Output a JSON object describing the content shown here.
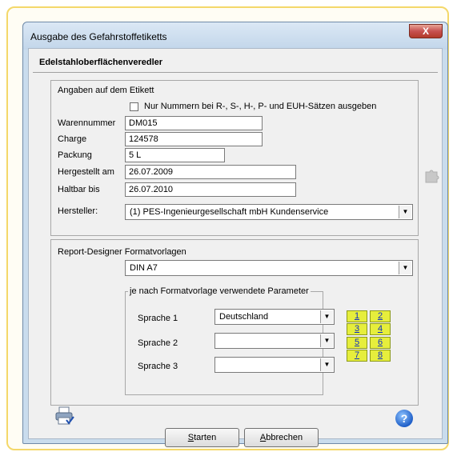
{
  "window": {
    "title": "Ausgabe des Gefahrstoffetiketts",
    "close_glyph": "X"
  },
  "company_name": "Edelstahloberflächenveredler",
  "label_group": {
    "title": "Angaben auf dem Etikett",
    "only_numbers_checkbox_label": "Nur Nummern bei R-, S-, H-, P- und EUH-Sätzen ausgeben",
    "only_numbers_checked": false,
    "fields": {
      "warennummer": {
        "label": "Warennummer",
        "value": "DM015"
      },
      "charge": {
        "label": "Charge",
        "value": "124578"
      },
      "packung": {
        "label": "Packung",
        "value": "5 L"
      },
      "hergestellt": {
        "label": "Hergestellt am",
        "value": "26.07.2009"
      },
      "haltbar": {
        "label": "Haltbar bis",
        "value": "26.07.2010"
      }
    },
    "hersteller": {
      "label": "Hersteller:",
      "value": "(1)  PES-Ingenieurgesellschaft mbH  Kundenservice"
    }
  },
  "report_group": {
    "title": "Report-Designer Formatvorlagen",
    "format_value": "DIN A7",
    "params_legend": "je nach Formatvorlage verwendete Parameter",
    "languages": [
      {
        "label": "Sprache 1",
        "value": "Deutschland"
      },
      {
        "label": "Sprache 2",
        "value": ""
      },
      {
        "label": "Sprache 3",
        "value": ""
      }
    ],
    "number_buttons": [
      "1",
      "2",
      "3",
      "4",
      "5",
      "6",
      "7",
      "8"
    ]
  },
  "buttons": {
    "start_u": "S",
    "start_rest": "tarten",
    "cancel_u": "A",
    "cancel_rest": "bbrechen"
  },
  "help_glyph": "?",
  "icons": {
    "printer": "printer-icon",
    "help": "help-icon",
    "puzzle": "puzzle-icon",
    "close": "close-icon"
  },
  "colors": {
    "frame": "#f4d86a",
    "number_button": "#e6ee3c",
    "titlebar": "#c2d6ea"
  }
}
